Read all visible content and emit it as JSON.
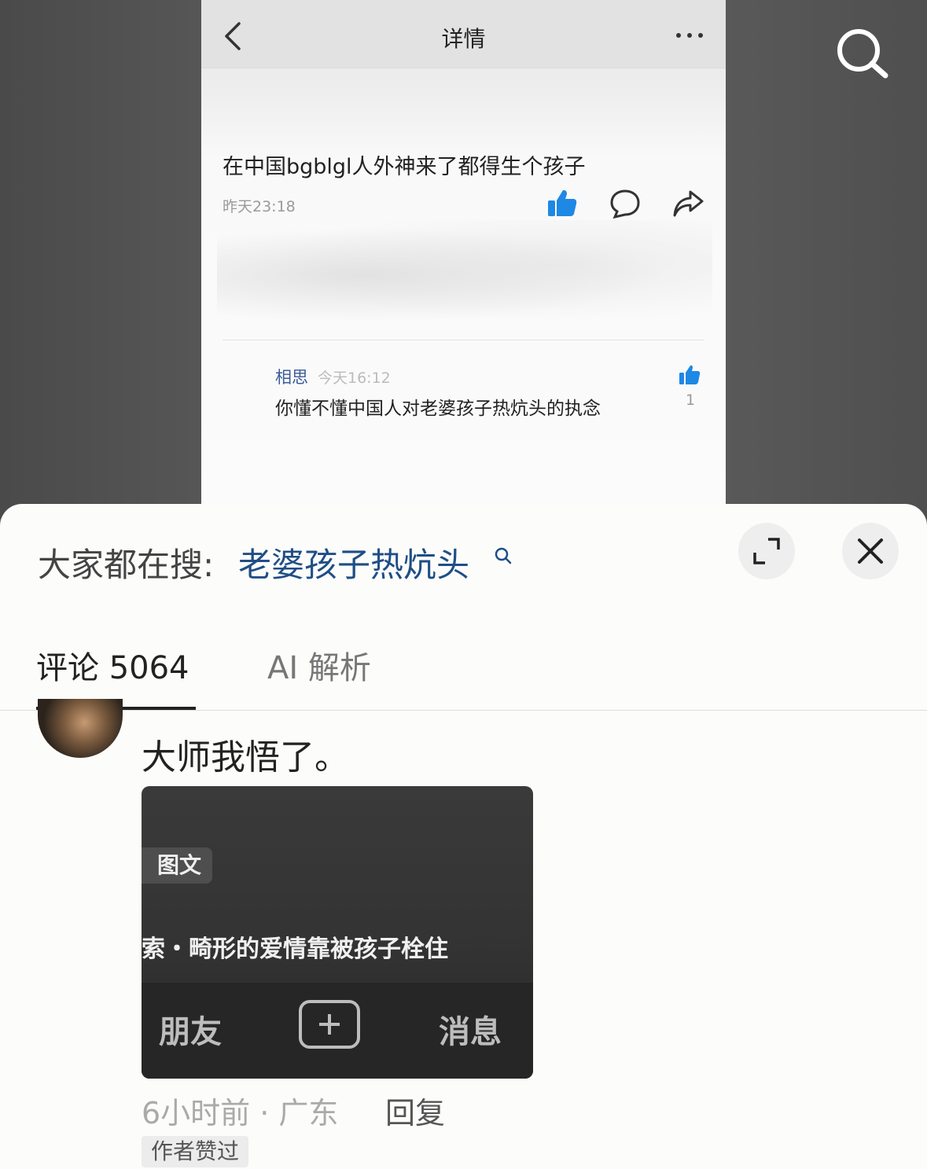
{
  "detail": {
    "nav_title": "详情",
    "post_text": "在中国bgblgl人外神来了都得生个孩子",
    "post_time": "昨天23:18",
    "comment": {
      "user": "相思",
      "time": "今天16:12",
      "text": "你懂不懂中国人对老婆孩子热炕头的执念",
      "like_count": "1"
    }
  },
  "sheet": {
    "search_label": "大家都在搜:",
    "search_term": "老婆孩子热炕头",
    "tabs": [
      {
        "label": "评论 5064",
        "active": true
      },
      {
        "label": "AI 解析",
        "active": false
      }
    ],
    "comment": {
      "text": "大师我悟了。",
      "image": {
        "badge": "图文",
        "title": "索・畸形的爱情靠被孩子栓住",
        "bar_left": "朋友",
        "bar_right": "消息"
      },
      "meta": "6小时前 · 广东",
      "reply_label": "回复",
      "tag": "作者赞过"
    }
  },
  "colors": {
    "accent_blue": "#1e88e5",
    "search_term": "#1f4e86",
    "username": "#3b5b98"
  },
  "icons": [
    "back-icon",
    "more-icon",
    "thumbs-up-icon",
    "comment-icon",
    "share-icon",
    "search-icon",
    "expand-icon",
    "close-icon",
    "plus-icon"
  ]
}
